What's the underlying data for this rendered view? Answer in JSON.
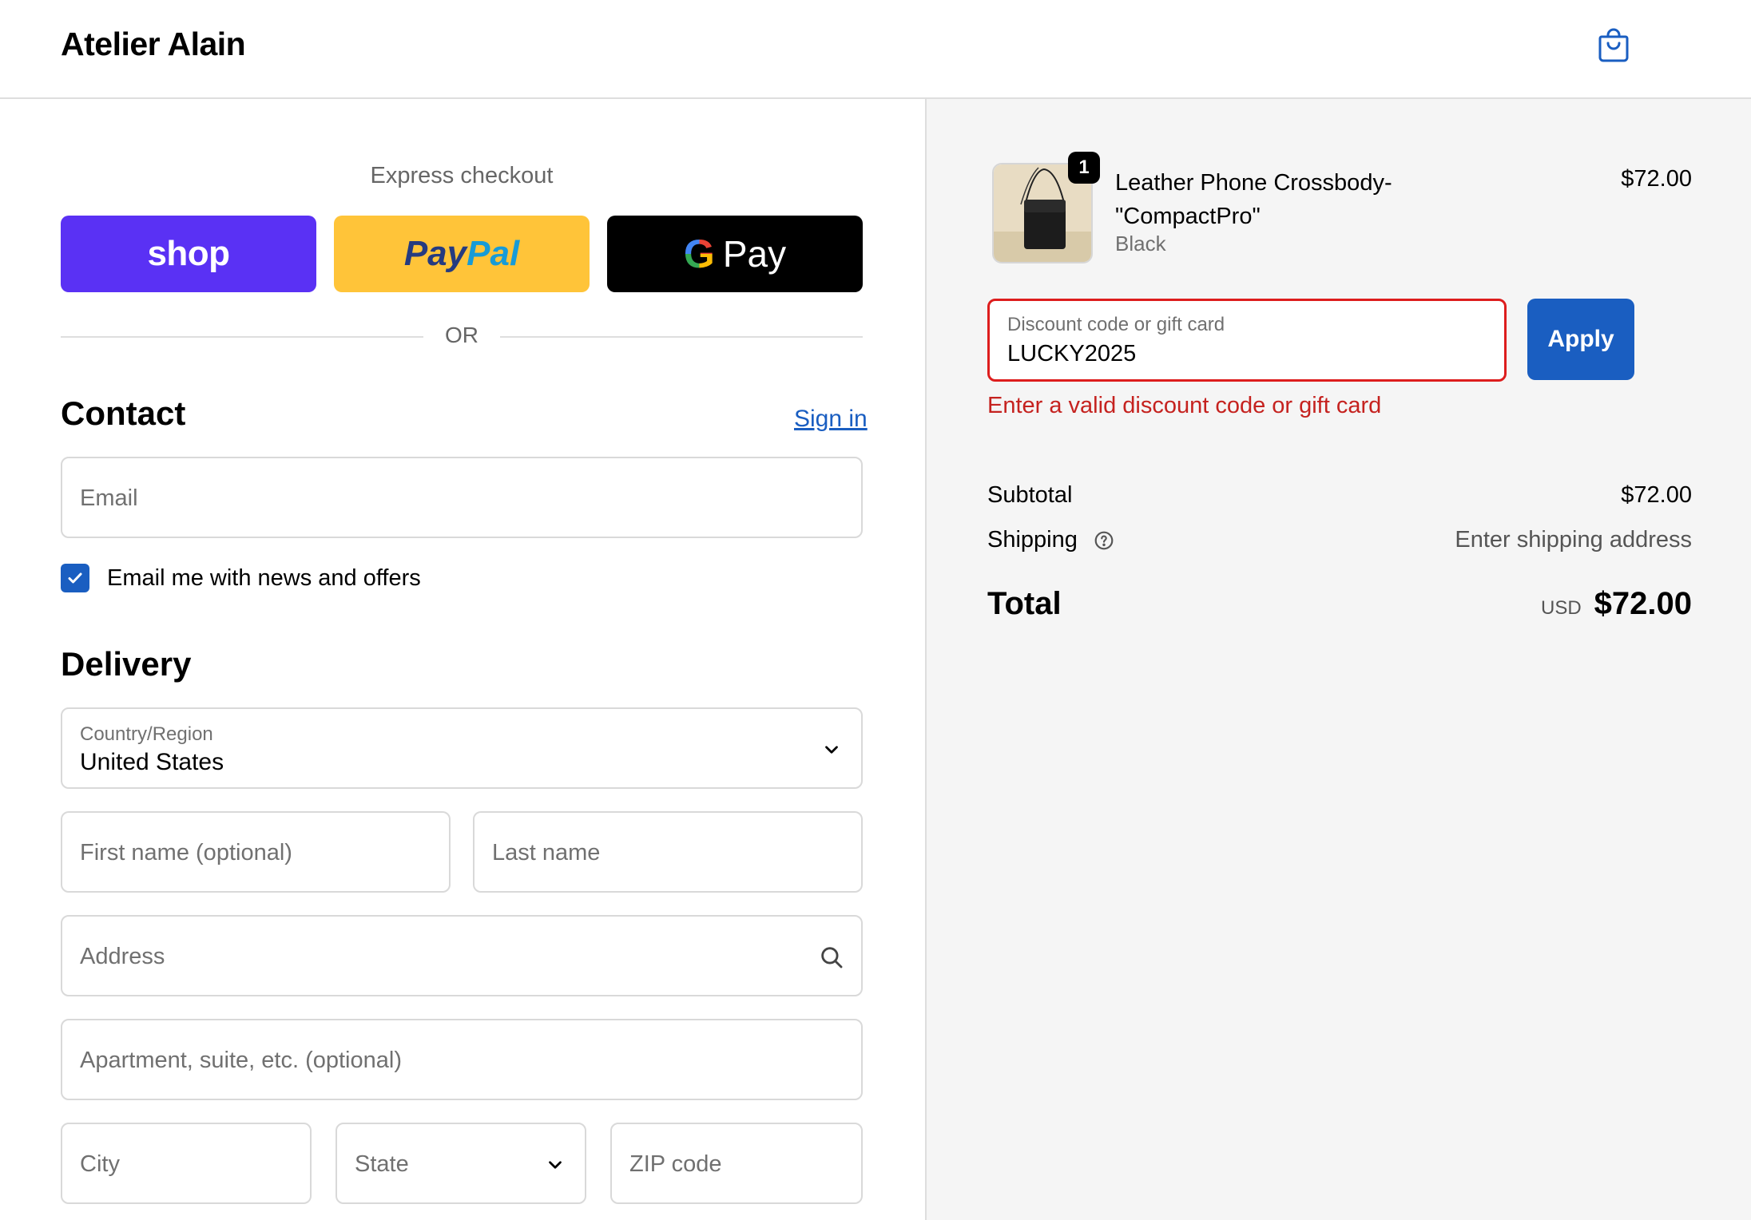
{
  "header": {
    "brand": "Atelier Alain",
    "cart_icon": "shopping-bag-icon"
  },
  "express": {
    "title": "Express checkout",
    "shop_label": "shop",
    "paypal_part1": "Pay",
    "paypal_part2": "Pal",
    "gpay_g": "G",
    "gpay_label": "Pay",
    "or_label": "OR"
  },
  "contact": {
    "title": "Contact",
    "sign_in": "Sign in",
    "email_placeholder": "Email",
    "newsletter_label": "Email me with news and offers",
    "newsletter_checked": true
  },
  "delivery": {
    "title": "Delivery",
    "country_label": "Country/Region",
    "country_value": "United States",
    "first_name_placeholder": "First name (optional)",
    "last_name_placeholder": "Last name",
    "address_placeholder": "Address",
    "apartment_placeholder": "Apartment, suite, etc. (optional)",
    "city_placeholder": "City",
    "state_placeholder": "State",
    "zip_placeholder": "ZIP code"
  },
  "order": {
    "item": {
      "quantity": "1",
      "name": "Leather Phone Crossbody-\"CompactPro\"",
      "variant": "Black",
      "price": "$72.00"
    },
    "discount": {
      "label": "Discount code or gift card",
      "value": "LUCKY2025",
      "apply_label": "Apply",
      "error": "Enter a valid discount code or gift card"
    },
    "subtotal_label": "Subtotal",
    "subtotal_value": "$72.00",
    "shipping_label": "Shipping",
    "shipping_value": "Enter shipping address",
    "total_label": "Total",
    "currency": "USD",
    "total_value": "$72.00"
  },
  "colors": {
    "shop_purple": "#5a31f4",
    "paypal_yellow": "#ffc439",
    "accent_blue": "#1a5ec1",
    "error_red": "#c5221f"
  }
}
